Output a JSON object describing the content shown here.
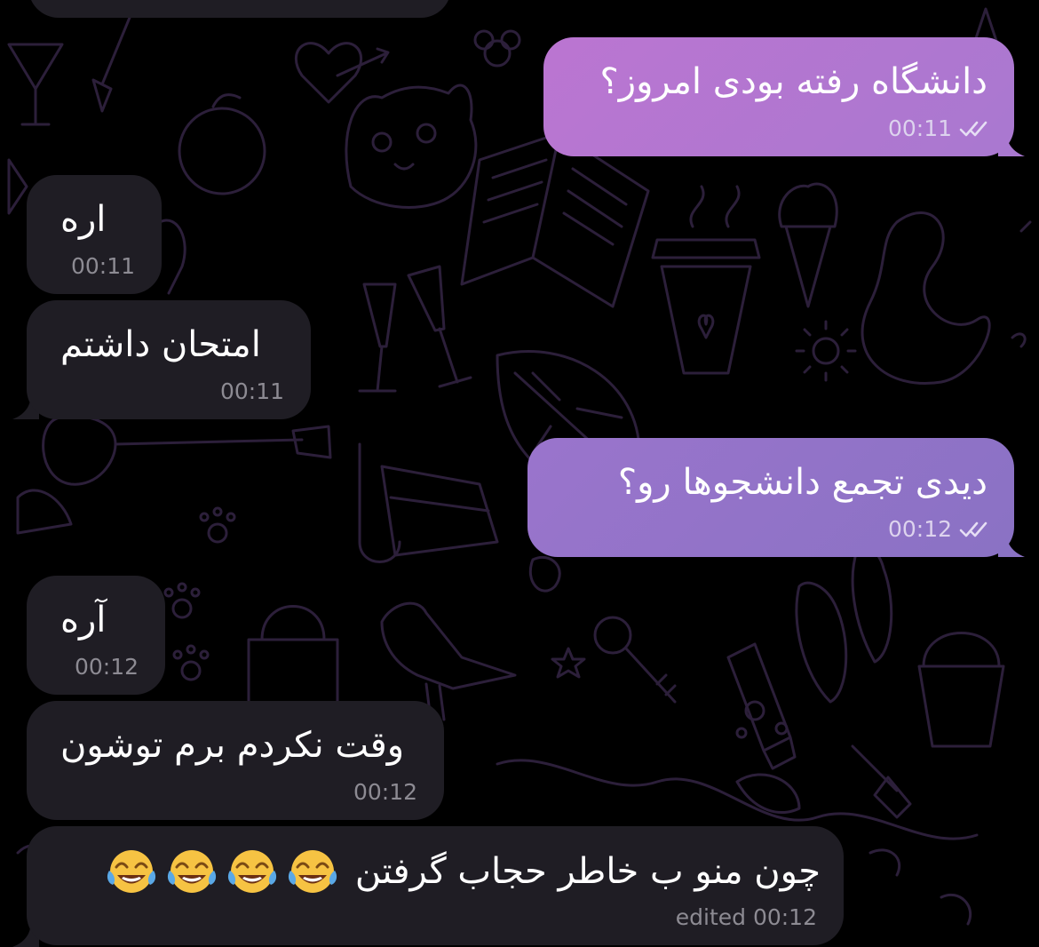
{
  "chat": {
    "messages": [
      {
        "id": "m1",
        "direction": "outgoing",
        "text": "دانشگاه رفته بودی امروز؟",
        "time": "00:11",
        "status": "read"
      },
      {
        "id": "m2",
        "direction": "incoming",
        "text": "اره",
        "time": "00:11"
      },
      {
        "id": "m3",
        "direction": "incoming",
        "text": "امتحان داشتم",
        "time": "00:11"
      },
      {
        "id": "m4",
        "direction": "outgoing",
        "text": "دیدی تجمع دانشجوها رو؟",
        "time": "00:12",
        "status": "read"
      },
      {
        "id": "m5",
        "direction": "incoming",
        "text": "آره",
        "time": "00:12"
      },
      {
        "id": "m6",
        "direction": "incoming",
        "text": "وقت نکردم برم توشون",
        "time": "00:12"
      },
      {
        "id": "m7",
        "direction": "incoming",
        "text": "چون منو ب خاطر حجاب گرفتن",
        "emoji": [
          "face-with-tears-of-joy",
          "face-with-tears-of-joy",
          "face-with-tears-of-joy",
          "face-with-tears-of-joy"
        ],
        "time": "edited 00:12"
      }
    ]
  },
  "icons": {
    "read_receipt": "double-check-icon",
    "emoji": "face-with-tears-of-joy"
  },
  "colors": {
    "background": "#000000",
    "incoming_bubble": "#1f1d24",
    "outgoing_gradient_start": "#b175d2",
    "outgoing_gradient_end": "#8f73c6",
    "pattern_stroke": "#2c1f3a",
    "incoming_meta": "#8d8b93",
    "outgoing_meta": "#ddd3ee"
  }
}
